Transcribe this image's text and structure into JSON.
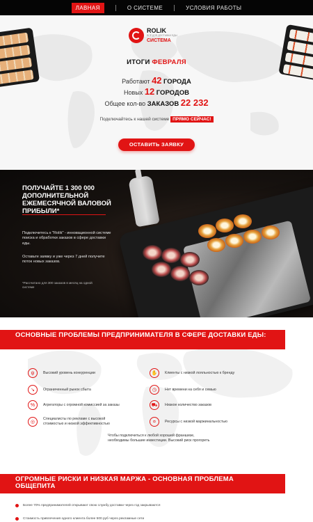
{
  "nav": {
    "items": [
      "ЛАВНАЯ",
      "О СИСТЕМЕ",
      "УСЛОВИЯ РАБОТЫ"
    ]
  },
  "brand": {
    "name": "ROLIK",
    "tagline": "ВСЁ ДЛЯ ДОСТАВКИ ЕДЫ",
    "system": "СИСТЕМА",
    "accent_color": "#e11414"
  },
  "hero": {
    "title_prefix": "ИТОГИ",
    "title_month": "ФЕВРАЛЯ",
    "stats": [
      {
        "label": "Работают",
        "value": "42",
        "unit": "ГОРОДА"
      },
      {
        "label": "Новых",
        "value": "12",
        "unit": "ГОРОДОВ"
      },
      {
        "label": "Общее кол-во",
        "value_label": "ЗАКАЗОВ",
        "value": "22 232"
      }
    ],
    "join_text": "Подключайтесь к нашей системе",
    "join_highlight": "ПРЯМО СЕЙЧАС!",
    "cta_label": "ОСТАВИТЬ ЗАЯВКУ"
  },
  "promo": {
    "title": "ПОЛУЧАЙТЕ 1 300 000 ДОПОЛНИТЕЛЬНОЙ ЕЖЕМЕСЯЧНОЙ ВАЛОВОЙ ПРИБЫЛИ*",
    "p1": "Подключитесь к \"Rolik\" - инновационной системе поиска и обработки заказов в сфере доставки еды.",
    "p2": "Оставьте заявку и уже через 7 дней получите поток новых заказов.",
    "footnote": "*Рассчитано для 300 заказов в месяц на одной системе"
  },
  "problems": {
    "title": "ОСНОВНЫЕ ПРОБЛЕМЫ ПРЕДПРИНИМАТЕЛЯ В СФЕРЕ ДОСТАВКИ ЕДЫ:",
    "left": [
      {
        "icon": "fork-knife-icon",
        "text": "Высокий уровень конкуренции"
      },
      {
        "icon": "chart-down-icon",
        "text": "Ограниченный рынок сбыта"
      },
      {
        "icon": "percent-icon",
        "text": "Агрегаторы с огромной комиссией за заказы"
      },
      {
        "icon": "megaphone-icon",
        "text": "Специалисты по рекламе с высокой стоимостью и низкой эффективностью"
      }
    ],
    "right": [
      {
        "icon": "handshake-icon",
        "text": "Клиенты с низкой лояльностью к бренду"
      },
      {
        "icon": "clock-icon",
        "text": "Нет времени на себя и семью"
      },
      {
        "icon": "cart-icon",
        "text": "Низкое количество заказов"
      },
      {
        "icon": "coins-icon",
        "text": "Ресурсы с низкой маржинальностью"
      }
    ],
    "note": "Чтобы подключиться к любой хорошей франшизе, необходимы большие инвестиции. Высокий риск прогореть"
  },
  "risks": {
    "title": "ОГРОМНЫЕ РИСКИ И НИЗКАЯ МАРЖА - ОСНОВНАЯ ПРОБЛЕМА ОБЩЕПИТА",
    "bullets": [
      "Более 70% предпринимателей открывают свою службу доставки через год закрываются",
      "Стоимость привлечения одного клиента более 500 руб через рекламные сети"
    ]
  }
}
